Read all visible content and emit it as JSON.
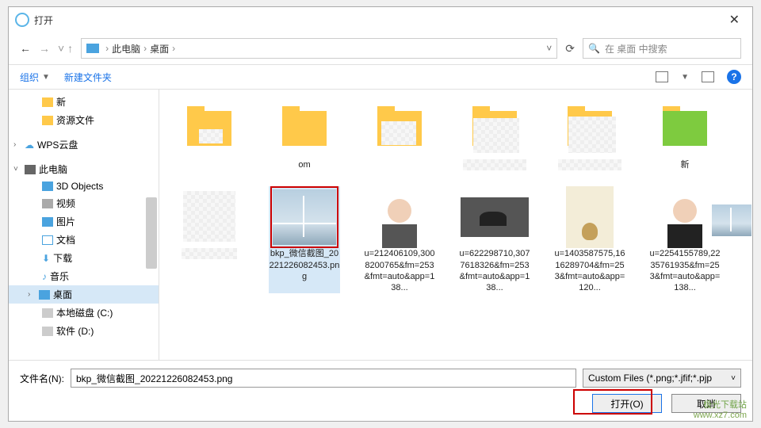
{
  "title": "打开",
  "breadcrumb": {
    "root": "此电脑",
    "folder": "桌面"
  },
  "search": {
    "placeholder": "在 桌面 中搜索"
  },
  "toolbar": {
    "organize": "组织",
    "newfolder": "新建文件夹"
  },
  "sidebar": {
    "items": [
      {
        "label": "新",
        "type": "folder",
        "indent": 1
      },
      {
        "label": "资源文件",
        "type": "folder",
        "indent": 1
      },
      {
        "label": "WPS云盘",
        "type": "cloud",
        "indent": 0,
        "caret": ">"
      },
      {
        "label": "此电脑",
        "type": "pc",
        "indent": 0,
        "caret": "v"
      },
      {
        "label": "3D Objects",
        "type": "obj3d",
        "indent": 1
      },
      {
        "label": "视频",
        "type": "video",
        "indent": 1
      },
      {
        "label": "图片",
        "type": "pic",
        "indent": 1
      },
      {
        "label": "文档",
        "type": "doc",
        "indent": 1
      },
      {
        "label": "下载",
        "type": "dl",
        "indent": 1
      },
      {
        "label": "音乐",
        "type": "music",
        "indent": 1
      },
      {
        "label": "桌面",
        "type": "desktop",
        "indent": 1,
        "selected": true,
        "caret": ">"
      },
      {
        "label": "本地磁盘 (C:)",
        "type": "disk",
        "indent": 1
      },
      {
        "label": "软件 (D:)",
        "type": "disk",
        "indent": 1
      }
    ]
  },
  "files": {
    "row1_om": "om",
    "row1_new": "新",
    "selected": {
      "label": "bkp_微信截图_20221226082453.png"
    },
    "u1": "u=212406109,3008200765&fm=253&fmt=auto&app=138...",
    "u2": "u=622298710,3077618326&fm=253&fmt=auto&app=138...",
    "u3": "u=1403587575,1616289704&fm=253&fmt=auto&app=120...",
    "u4": "u=2254155789,2235761935&fm=253&fmt=auto&app=138..."
  },
  "footer": {
    "filename_label": "文件名(N):",
    "filename_value": "bkp_微信截图_20221226082453.png",
    "filetype": "Custom Files (*.png;*.jfif;*.pjp",
    "open": "打开(O)",
    "cancel": "取消"
  },
  "watermark": {
    "line1": "极光下载站",
    "line2": "www.xz7.com"
  }
}
